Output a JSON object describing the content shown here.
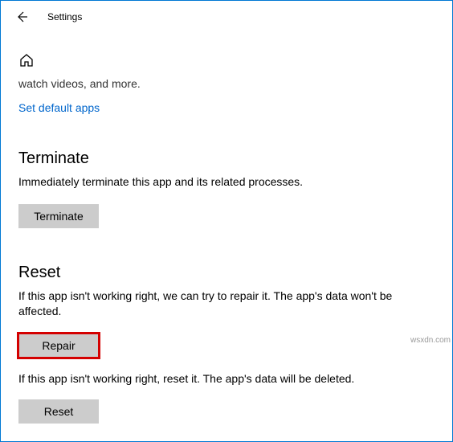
{
  "header": {
    "title": "Settings"
  },
  "truncated_line": "watch videos, and more.",
  "link_set_default": "Set default apps",
  "terminate": {
    "heading": "Terminate",
    "description": "Immediately terminate this app and its related processes.",
    "button": "Terminate"
  },
  "reset": {
    "heading": "Reset",
    "repair_description": "If this app isn't working right, we can try to repair it. The app's data won't be affected.",
    "repair_button": "Repair",
    "reset_description": "If this app isn't working right, reset it. The app's data will be deleted.",
    "reset_button": "Reset"
  },
  "watermark": "wsxdn.com"
}
